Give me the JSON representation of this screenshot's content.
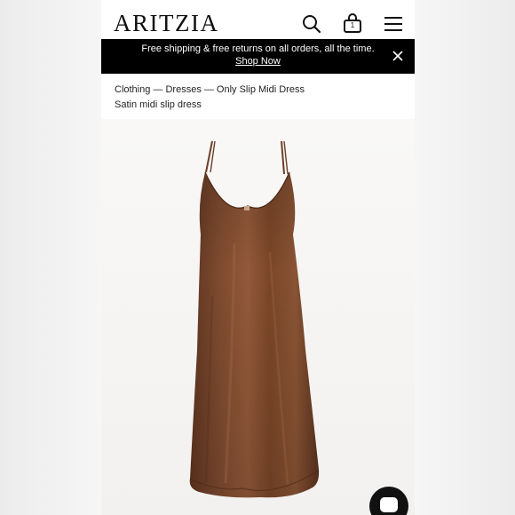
{
  "header": {
    "logo": "ARITZIA",
    "bag_count": "1",
    "icons": [
      "search-icon",
      "bag-icon",
      "hamburger-menu-icon"
    ]
  },
  "promo": {
    "text": "Free shipping & free returns on all orders, all the time.",
    "link": "Shop Now",
    "close_icon": "close-icon"
  },
  "breadcrumb": "Clothing — Dresses — Only Slip Midi Dress",
  "subtitle": "Satin midi slip dress",
  "product": {
    "color": "#7a4a30"
  },
  "chat": {
    "icon": "chat-icon"
  }
}
